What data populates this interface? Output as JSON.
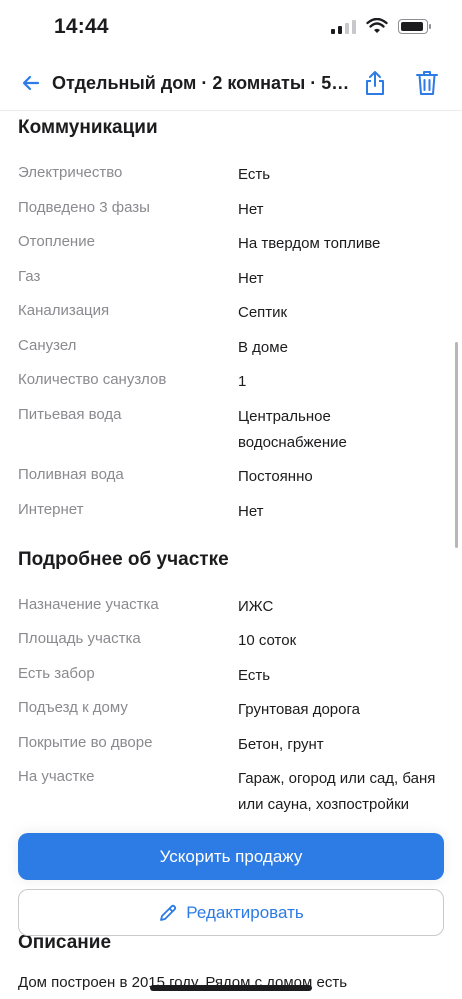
{
  "status_bar": {
    "time": "14:44"
  },
  "header": {
    "title": "Отдельный дом · 2 комнаты · 56 м..."
  },
  "communications": {
    "title": "Коммуникации",
    "rows": [
      {
        "key": "Электричество",
        "value": "Есть"
      },
      {
        "key": "Подведено 3 фазы",
        "value": "Нет"
      },
      {
        "key": "Отопление",
        "value": "На твердом топливе"
      },
      {
        "key": "Газ",
        "value": "Нет"
      },
      {
        "key": "Канализация",
        "value": "Септик"
      },
      {
        "key": "Санузел",
        "value": "В доме"
      },
      {
        "key": "Количество санузлов",
        "value": "1"
      },
      {
        "key": "Питьевая вода",
        "value_line1": "Центральное",
        "value_line2": "водоснабжение"
      },
      {
        "key": "Поливная вода",
        "value": "Постоянно"
      },
      {
        "key": "Интернет",
        "value": "Нет"
      }
    ]
  },
  "plot": {
    "title": "Подробнее об участке",
    "rows": [
      {
        "key": "Назначение участка",
        "value": "ИЖС"
      },
      {
        "key": "Площадь участка",
        "value": "10 соток"
      },
      {
        "key": "Есть забор",
        "value": "Есть"
      },
      {
        "key": "Подъезд к дому",
        "value": "Грунтовая дорога"
      },
      {
        "key": "Покрытие во дворе",
        "value": "Бетон, грунт"
      },
      {
        "key": "На участке",
        "value_line1": "Гараж, огород или сад, баня",
        "value_line2": "или сауна, хозпостройки"
      }
    ]
  },
  "actions": {
    "boost_label": "Ускорить продажу",
    "edit_label": "Редактировать"
  },
  "description": {
    "title": "Описание",
    "text": "Дом построен в 2015 году. Рядом с домом есть"
  },
  "colors": {
    "accent": "#2d7be5",
    "muted_text": "#8a8a8f"
  }
}
